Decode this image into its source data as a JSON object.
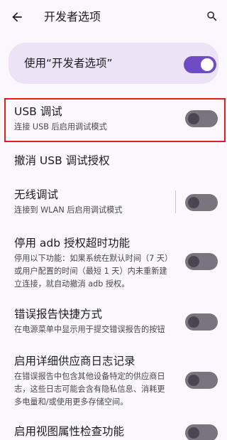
{
  "header": {
    "title": "开发者选项",
    "back_icon": "arrow-left-icon",
    "search_icon": "search-icon"
  },
  "master_toggle": {
    "label": "使用“开发者选项”",
    "state": "on",
    "accent": "#6f4cc3"
  },
  "settings": [
    {
      "id": "usb-debugging",
      "title": "USB 调试",
      "subtitle": "连接 USB 后启用调试模式",
      "toggle": "off",
      "highlighted": true
    },
    {
      "id": "revoke-usb-auth",
      "title": "撤消 USB 调试授权",
      "subtitle": null,
      "toggle": null
    },
    {
      "id": "wireless-debugging",
      "title": "无线调试",
      "subtitle": "连接到 WLAN 后启用调试模式",
      "toggle": "off"
    },
    {
      "id": "disable-adb-timeout",
      "title": "停用 adb 授权超时功能",
      "subtitle": "停用以下功能：如果系统在默认时间（7 天）或用户配置的时间（最短 1 天）内未重新建立连接，就自动撤消 adb 授权。",
      "toggle": "off"
    },
    {
      "id": "bug-report-shortcut",
      "title": "错误报告快捷方式",
      "subtitle": "在电源菜单中显示用于提交错误报告的按钮",
      "toggle": "off"
    },
    {
      "id": "verbose-vendor-logging",
      "title": "启用详细供应商日志记录",
      "subtitle": "在错误报告中包含其他设备特定的供应商日志，这些日志可能会含有隐私信息、消耗更多电量和/或使用更多存储空间。",
      "toggle": "off"
    },
    {
      "id": "view-attribute-inspection",
      "title": "启用视图属性检查功能",
      "subtitle": null,
      "toggle": "off"
    }
  ],
  "colors": {
    "background": "#fbf8fd",
    "highlight_border": "#e11d1d",
    "switch_off_track": "#79747e"
  }
}
